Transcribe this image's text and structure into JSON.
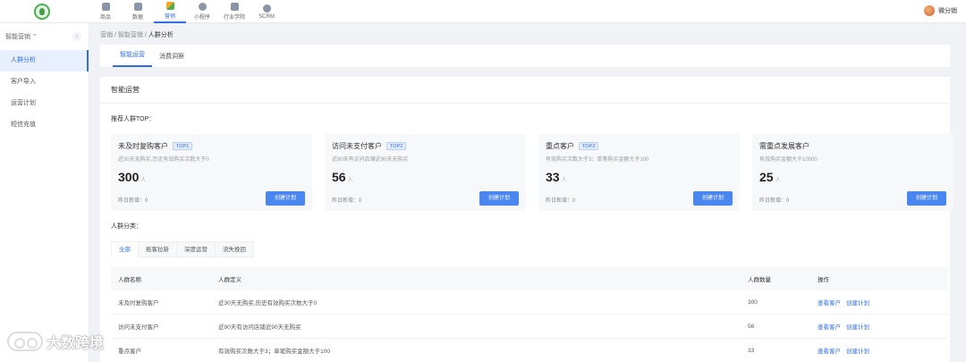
{
  "topnav": {
    "items": [
      {
        "label": "商品",
        "icon": "shop-icon"
      },
      {
        "label": "数据",
        "icon": "chart-icon"
      },
      {
        "label": "营销",
        "icon": "apps-icon"
      },
      {
        "label": "小程序",
        "icon": "miniapp-icon"
      },
      {
        "label": "行业学院",
        "icon": "graduation-cap-icon"
      },
      {
        "label": "SCRM",
        "icon": "pie-icon"
      }
    ],
    "active_index": 2,
    "user_name": "微分销"
  },
  "sidebar": {
    "header": "智能营销",
    "items": [
      "人群分析",
      "客户导入",
      "运营计划",
      "短信充值"
    ],
    "active_index": 0
  },
  "breadcrumb": {
    "first": "营销",
    "second": "智能营销",
    "current": "人群分析",
    "sep": "/"
  },
  "main_tabs": [
    "智能运营",
    "消费洞察"
  ],
  "panel": {
    "title": "智能运营",
    "top_title": "推荐人群TOP：",
    "cards": [
      {
        "name": "未及时复购客户",
        "tag": "TOP1",
        "desc": "近30天无购买,历史有效购买次数大于0",
        "count": "300",
        "unit": "人",
        "foot": "昨日新增：0",
        "button": "创建计划"
      },
      {
        "name": "访问未支付客户",
        "tag": "TOP2",
        "desc": "近90天有访问店铺近90天无购买",
        "count": "56",
        "unit": "人",
        "foot": "昨日新增：0",
        "button": "创建计划"
      },
      {
        "name": "重点客户",
        "tag": "TOP3",
        "desc": "有效购买次数大于3；单笔购买金额大于100",
        "count": "33",
        "unit": "人",
        "foot": "昨日新增：0",
        "button": "创建计划"
      },
      {
        "name": "需重点发展客户",
        "tag": "",
        "desc": "有效购买金额大于10000",
        "count": "25",
        "unit": "人",
        "foot": "昨日新增：0",
        "button": "创建计划"
      }
    ],
    "class_title": "人群分类：",
    "filter_tabs": [
      "全部",
      "拓客拉新",
      "深度运营",
      "流失挽回"
    ],
    "table": {
      "headers": [
        "人群名称",
        "人群定义",
        "人群数量",
        "操作"
      ],
      "rows": [
        {
          "name": "未及时复购客户",
          "def": "近30天无购买,历史有效购买次数大于0",
          "count": "300",
          "op1": "查看客户",
          "op2": "创建计划"
        },
        {
          "name": "访问未支付客户",
          "def": "近90天有访问店铺近90天无购买",
          "count": "56",
          "op1": "查看客户",
          "op2": "创建计划"
        },
        {
          "name": "重点客户",
          "def": "有效购买次数大于3；单笔购买金额大于100",
          "count": "33",
          "op1": "查看客户",
          "op2": "创建计划"
        }
      ]
    }
  },
  "watermark": "大数跨境",
  "colors": {
    "accent": "#2f6ee8",
    "button": "#4a86f0",
    "bg": "#f0f2f5"
  }
}
